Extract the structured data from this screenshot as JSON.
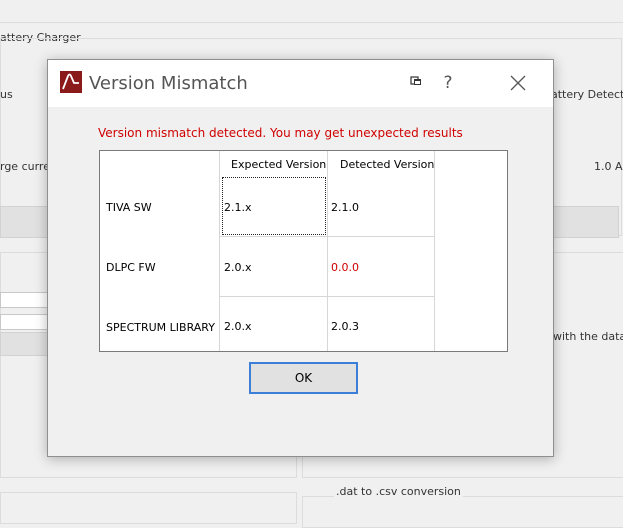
{
  "background": {
    "labels": {
      "battery_charger": "attery Charger",
      "status_left": "us",
      "battery_detected": "attery Detected",
      "charge_current": "rge curren",
      "current_value": "1.0 A",
      "with_data": "with the data t",
      "csv_conversion": ".dat to .csv conversion"
    }
  },
  "dialog": {
    "title": "Version Mismatch",
    "help_label": "?",
    "message": "Version mismatch detected. You may get unexpected results",
    "table": {
      "headers": [
        "",
        "Expected Version",
        "Detected Version"
      ],
      "rows": [
        {
          "component": "TIVA SW",
          "expected": "2.1.x",
          "detected": "2.1.0"
        },
        {
          "component": "DLPC FW",
          "expected": "2.0.x",
          "detected": "0.0.0"
        },
        {
          "component": "SPECTRUM LIBRARY",
          "expected": "2.0.x",
          "detected": "2.0.3"
        }
      ]
    },
    "ok_label": "OK"
  },
  "colors": {
    "error_text": "#d00000",
    "focus_border": "#3c7fd9",
    "app_icon": "#8b1a1a"
  },
  "icons": {
    "app": "app-logo-icon",
    "restore": "restore-icon",
    "help": "help-icon",
    "close": "close-icon"
  }
}
